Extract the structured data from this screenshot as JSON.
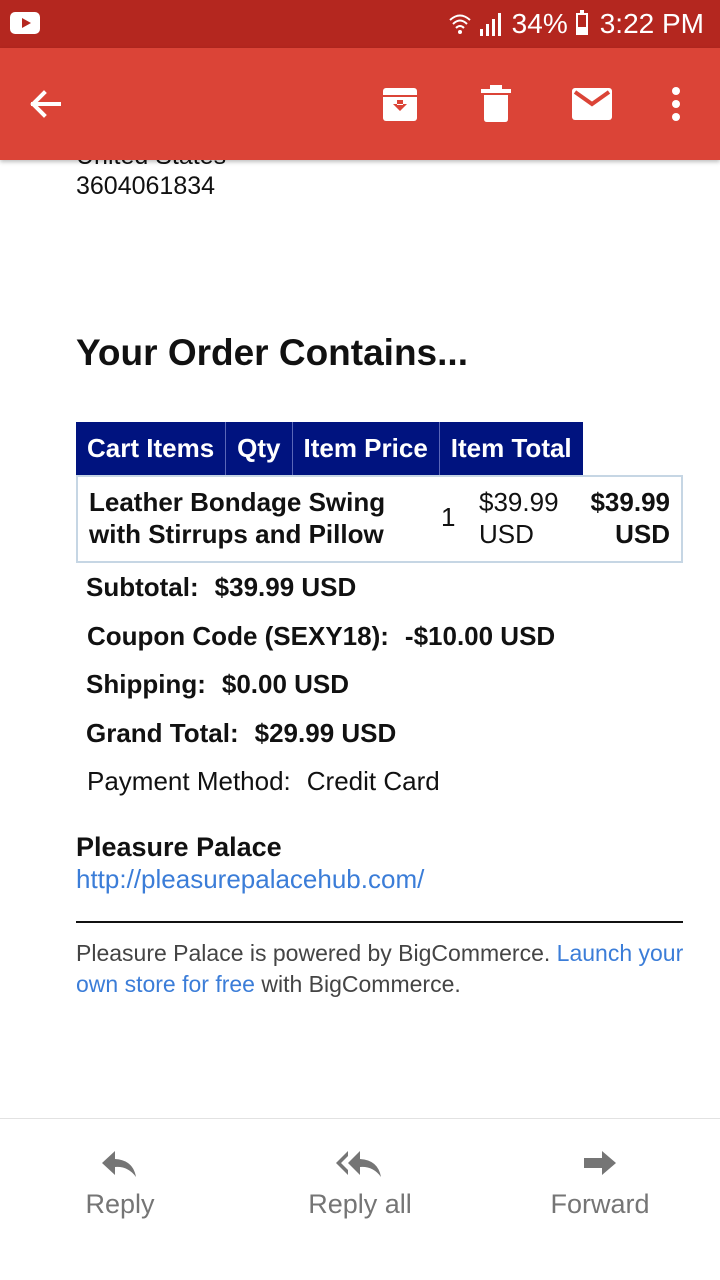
{
  "status_bar": {
    "battery": "34%",
    "time": "3:22 PM"
  },
  "email": {
    "address_partial": "United States",
    "phone": "3604061834",
    "section_title": "Your Order Contains...",
    "cart": {
      "headers": [
        "Cart Items",
        "Qty",
        "Item Price",
        "Item Total"
      ],
      "rows": [
        {
          "name_line1": "Leather Bondage Swing",
          "name_line2": "with Stirrups and Pillow",
          "qty": "1",
          "price_line1": "$39.99",
          "price_line2": "USD",
          "total_line1": "$39.99",
          "total_line2": "USD"
        }
      ]
    },
    "summary": {
      "subtotal_label": "Subtotal:",
      "subtotal_value": "$39.99 USD",
      "coupon_label": "Coupon Code (SEXY18):",
      "coupon_value": "-$10.00 USD",
      "shipping_label": "Shipping:",
      "shipping_value": "$0.00 USD",
      "grand_total_label": "Grand Total:",
      "grand_total_value": "$29.99 USD",
      "payment_label": "Payment Method:",
      "payment_value": "Credit Card"
    },
    "store": {
      "name": "Pleasure Palace",
      "url": "http://pleasurepalacehub.com/"
    },
    "footer": {
      "text_before": "Pleasure Palace is powered by BigCommerce. ",
      "link_text": "Launch your own store for free",
      "text_after": " with BigCommerce."
    }
  },
  "actions": {
    "reply": "Reply",
    "reply_all": "Reply all",
    "forward": "Forward"
  },
  "icons": {
    "back": "arrow-back-icon",
    "archive": "archive-icon",
    "delete": "trash-icon",
    "mark_unread": "mail-icon",
    "more": "more-vert-icon"
  },
  "colors": {
    "status_bar": "#b4271f",
    "app_bar": "#db4437",
    "table_header": "#00137f",
    "link": "#3b7dd8"
  }
}
